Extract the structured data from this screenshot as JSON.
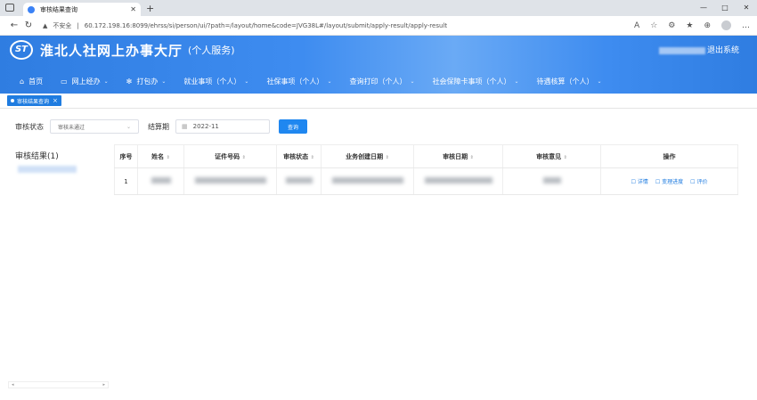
{
  "browser": {
    "tab_title": "审核结果查询",
    "not_secure": "不安全",
    "url": "60.172.198.16:8099/ehrss/si/person/ui/?path=/layout/home&code=JVG38L#/layout/submit/apply-result/apply-result"
  },
  "header": {
    "logo_mark": "ST",
    "title": "淮北人社网上办事大厅",
    "subtitle": "(个人服务)",
    "logout": "退出系统"
  },
  "menu": [
    {
      "label": "首页",
      "icon": "home-icon",
      "arrow": false
    },
    {
      "label": "网上经办",
      "icon": "monitor-icon",
      "arrow": true
    },
    {
      "label": "打包办",
      "icon": "gear-icon",
      "arrow": true
    },
    {
      "label": "就业事项（个人）",
      "icon": "",
      "arrow": true
    },
    {
      "label": "社保事项（个人）",
      "icon": "",
      "arrow": true
    },
    {
      "label": "查询打印（个人）",
      "icon": "",
      "arrow": true
    },
    {
      "label": "社会保障卡事项（个人）",
      "icon": "",
      "arrow": true
    },
    {
      "label": "待遇核算（个人）",
      "icon": "",
      "arrow": true
    }
  ],
  "active_tag": "审核结果查询",
  "filters": {
    "status_label": "审核状态",
    "status_value": "审核未通过",
    "period_label": "结算期",
    "period_value": "2022-11",
    "query_button": "查询"
  },
  "side": {
    "title": "审核结果(1)"
  },
  "table": {
    "headers": [
      "序号",
      "姓名",
      "证件号码",
      "审核状态",
      "业务创建日期",
      "审核日期",
      "审核意见",
      "操作"
    ],
    "rows": [
      {
        "index": "1",
        "actions": [
          "详情",
          "变理进度",
          "评价"
        ]
      }
    ]
  }
}
